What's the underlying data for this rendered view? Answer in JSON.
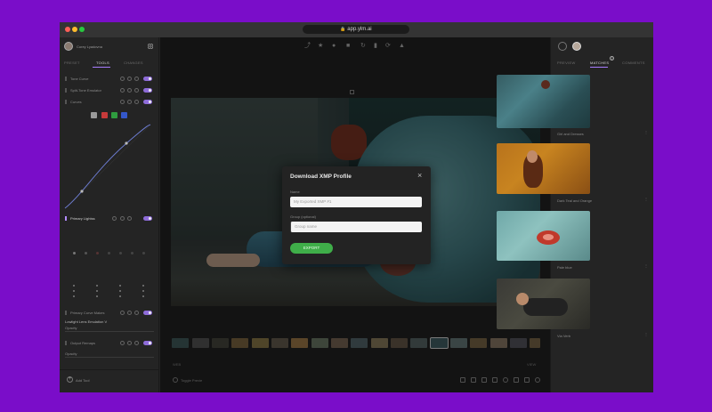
{
  "browser": {
    "url": "app.ylm.ai"
  },
  "left": {
    "user": "Corey Lyadovna",
    "tabs": [
      "PRESET",
      "TOOLS",
      "CHANGES"
    ],
    "rows": [
      "Tone Curve",
      "Split-Tone Emulator",
      "Curves"
    ],
    "curve_channels": [
      "RGB",
      "R",
      "G",
      "B"
    ],
    "primary_title": "Primary Lightss",
    "lower_rows": [
      "Primary Curve Makes",
      "Double Lens Emulation",
      "Output Remaps"
    ],
    "lower_sub": [
      "Lowlight Lens Emulation V",
      "Opacity",
      "Opacity"
    ],
    "add_tool": "Add Tool"
  },
  "center": {
    "footer_left": "WEB",
    "footer_right": "VIEW",
    "toggle_preview": "Toggle Previe"
  },
  "modal": {
    "title": "Download XMP Profile",
    "name_label": "Name",
    "name_placeholder": "My Exported XMP #1",
    "group_label": "Group (optional)",
    "group_placeholder": "Group name",
    "export_label": "EXPORT",
    "export_color": "#3fae49"
  },
  "right": {
    "tabs": [
      "PREVIEW",
      "MATCHES",
      "COMMENTS"
    ],
    "matches_badge": "2",
    "matches": [
      {
        "title": "Girl and Dresses"
      },
      {
        "title": "Dark Teal and Orange"
      },
      {
        "title": "Pale blue"
      },
      {
        "title": "Via Verb"
      }
    ]
  }
}
